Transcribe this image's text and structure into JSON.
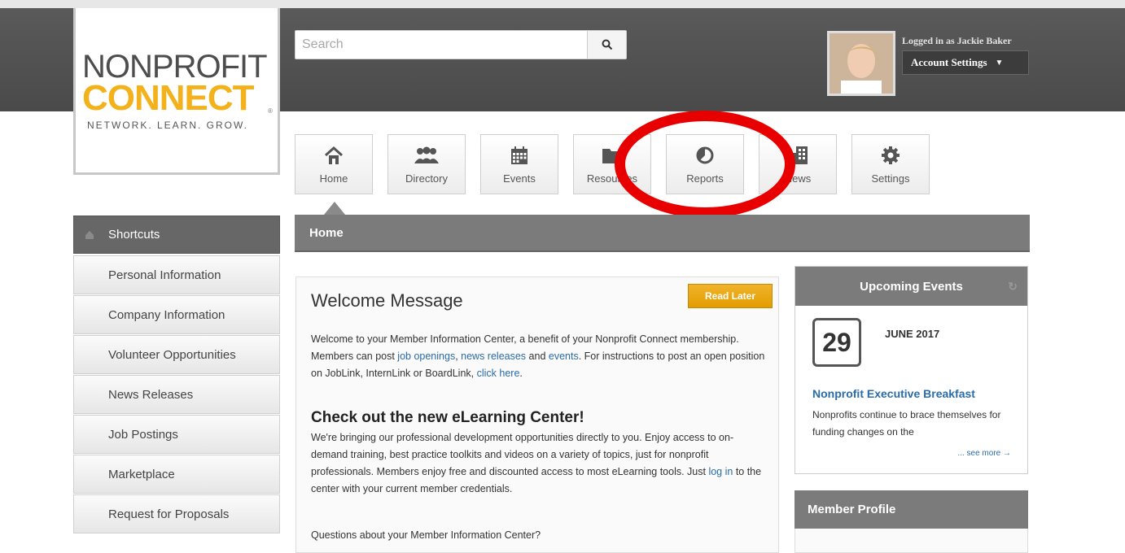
{
  "brand": {
    "logo_line1": "NONPROFIT",
    "logo_line2": "CONNECT",
    "tagline": "NETWORK. LEARN. GROW.",
    "logo_color_accent": "#f3b21b"
  },
  "search": {
    "placeholder": "Search",
    "icon": "search-icon"
  },
  "user": {
    "logged_in_text": "Logged in as Jackie Baker",
    "account_settings_label": "Account Settings",
    "avatar_icon": "user-avatar"
  },
  "nav": {
    "items": [
      {
        "label": "Home",
        "icon": "home-icon"
      },
      {
        "label": "Directory",
        "icon": "people-icon"
      },
      {
        "label": "Events",
        "icon": "calendar-icon"
      },
      {
        "label": "Resources",
        "icon": "folder-icon"
      },
      {
        "label": "Reports",
        "icon": "pie-chart-icon"
      },
      {
        "label": "News",
        "icon": "building-icon"
      },
      {
        "label": "Settings",
        "icon": "gear-icon"
      }
    ],
    "highlight_color": "#e80000"
  },
  "sidebar": {
    "heading": "Shortcuts",
    "items": [
      {
        "label": "Personal Information"
      },
      {
        "label": "Company Information"
      },
      {
        "label": "Volunteer Opportunities"
      },
      {
        "label": "News Releases"
      },
      {
        "label": "Job Postings"
      },
      {
        "label": "Marketplace"
      },
      {
        "label": "Request for Proposals"
      }
    ]
  },
  "main": {
    "section_title": "Home",
    "welcome": {
      "title": "Welcome Message",
      "read_later_label": "Read Later",
      "p1_a": "Welcome to your Member Information Center, a benefit of your Nonprofit Connect membership. Members can post ",
      "link_job_openings": "job openings",
      "p1_b": ", ",
      "link_news_releases": "news releases",
      "p1_c": " and ",
      "link_events": "events",
      "p1_d": ". For instructions to post an open position on JobLink, InternLink or BoardLink, ",
      "link_click_here": "click here",
      "p1_e": ".",
      "heading2": "Check out the new eLearning Center!",
      "p2_a": "We're bringing our professional development opportunities directly to you. Enjoy access to on-demand training, best practice toolkits and videos on a variety of topics, just for nonprofit professionals. Members enjoy free and discounted access to most eLearning tools. Just ",
      "link_log_in": "log in",
      "p2_b": " to the center with your current member credentials.",
      "p3": "Questions about your Member Information Center?"
    }
  },
  "events": {
    "heading": "Upcoming Events",
    "day": "29",
    "month_year": "JUNE 2017",
    "title": "Nonprofit Executive Breakfast",
    "description": "Nonprofits continue to brace themselves for funding changes on the",
    "see_more": "... see more →"
  },
  "member_profile": {
    "heading": "Member Profile"
  }
}
